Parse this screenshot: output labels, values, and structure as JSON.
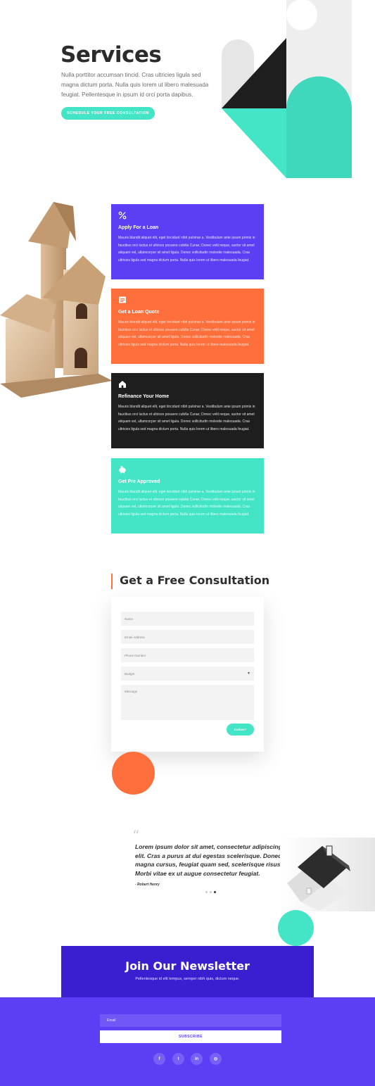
{
  "colors": {
    "purple": "#5c3ff4",
    "orange": "#ff6f3c",
    "dark": "#1e1e1e",
    "teal": "#43e5c6",
    "deep_purple": "#3a1fd0"
  },
  "hero": {
    "title": "Services",
    "text": "Nulla porttitor accumsan tincid. Cras ultricies ligula sed magna dictum porta. Nulla quis lorem ut libero malesuada feugiat. Pellentesque in ipsum id orci porta dapibus.",
    "button": "SCHEDULE YOUR FREE CONSULTATION"
  },
  "services": [
    {
      "icon": "percent-icon",
      "title": "Apply For a Loan",
      "body": "Mauris blandit aliquet elit, eget tincidunt nibh pulvinar a. Vestibulum ante ipsum primis in faucibus orci luctus et ultrices posuere cubilia Curae; Donec velit neque, auctor sit amet aliquam vel, ullamcorper sit amet ligula. Donec sollicitudin molestie malesuada. Cras ultricies ligula sed magna dictum porta. Nulla quis lorem ut libero malesuada feugiat.",
      "bg": "#5c3ff4"
    },
    {
      "icon": "document-icon",
      "title": "Get a Loan Quote",
      "body": "Mauris blandit aliquet elit, eget tincidunt nibh pulvinar a. Vestibulum ante ipsum primis in faucibus orci luctus et ultrices posuere cubilia Curae; Donec velit neque, auctor sit amet aliquam vel, ullamcorper sit amet ligula. Donec sollicitudin molestie malesuada. Cras ultricies ligula sed magna dictum porta. Nulla quis lorem ut libero malesuada feugiat.",
      "bg": "#ff6f3c"
    },
    {
      "icon": "home-icon",
      "title": "Refinance Your Home",
      "body": "Mauris blandit aliquet elit, eget tincidunt nibh pulvinar a. Vestibulum ante ipsum primis in faucibus orci luctus et ultrices posuere cubilia Curae; Donec velit neque, auctor sit amet aliquam vel, ullamcorper sit amet ligula. Donec sollicitudin molestie malesuada. Cras ultricies ligula sed magna dictum porta. Nulla quis lorem ut libero malesuada feugiat.",
      "bg": "#1e1e1e"
    },
    {
      "icon": "piggy-bank-icon",
      "title": "Get Pre Approved",
      "body": "Mauris blandit aliquet elit, eget tincidunt nibh pulvinar a. Vestibulum ante ipsum primis in faucibus orci luctus et ultrices posuere cubilia Curae; Donec velit neque, auctor sit amet aliquam vel, ullamcorper sit amet ligula. Donec sollicitudin molestie malesuada. Cras ultricies ligula sed magna dictum porta. Nulla quis lorem ut libero malesuada feugiat.",
      "bg": "#43e5c6"
    }
  ],
  "consultation": {
    "title": "Get a Free Consultation",
    "name_placeholder": "Name",
    "email_placeholder": "Email Address",
    "phone_placeholder": "Phone Number",
    "budget_label": "Budget",
    "message_placeholder": "Message",
    "submit": "SUBMIT"
  },
  "testimonial": {
    "quote_mark": "“",
    "text": "Lorem ipsum dolor sit amet, consectetur adipiscing elit. Cras a purus at dui egestas scelerisque. Donec at magna cursus, feugiat quam sed, scelerisque risus. Morbi vitae ex ut augue consectetur feugiat.",
    "author": "- Robert Henry",
    "slide_count": 3,
    "active_slide": 3
  },
  "newsletter": {
    "title": "Join Our Newsletter",
    "subtitle": "Pellentesque id elit tempus, semper nibh quis, dictum neque.",
    "email_placeholder": "Email",
    "subscribe": "SUBSCRIBE"
  },
  "social": [
    {
      "icon": "facebook-icon",
      "glyph": "f"
    },
    {
      "icon": "twitter-icon",
      "glyph": "t"
    },
    {
      "icon": "linkedin-icon",
      "glyph": "in"
    },
    {
      "icon": "instagram-icon",
      "glyph": "◎"
    }
  ]
}
